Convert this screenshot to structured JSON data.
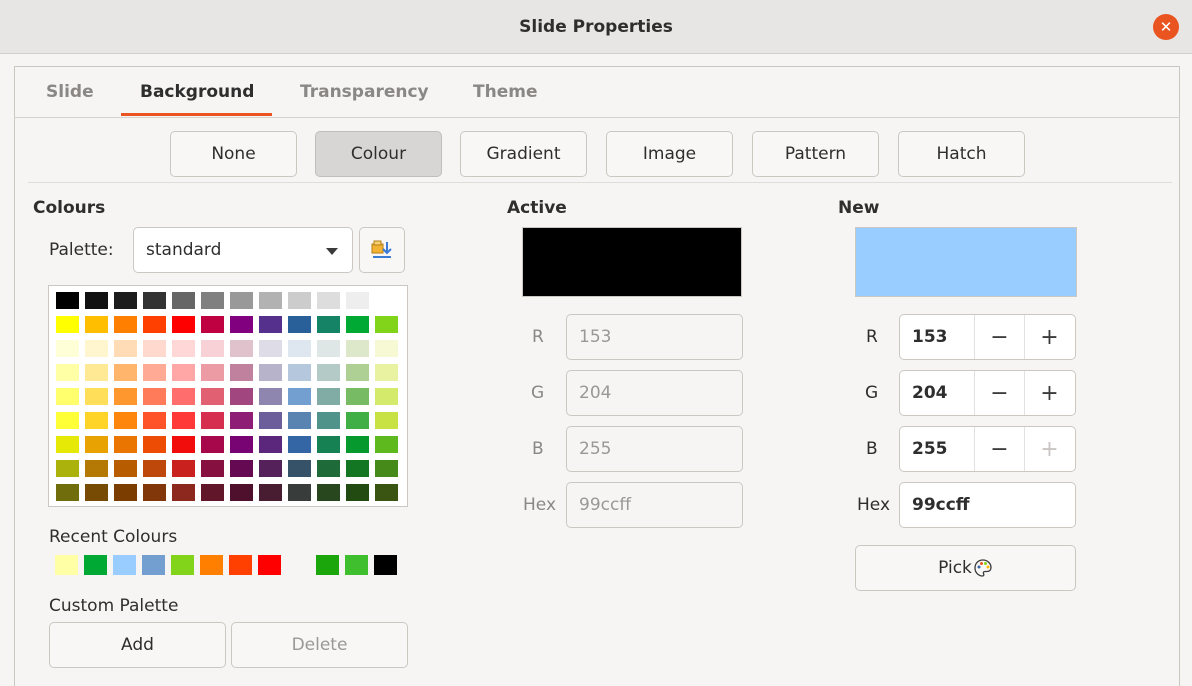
{
  "window": {
    "title": "Slide Properties",
    "close_icon": "close-icon"
  },
  "tabs": [
    {
      "label": "Slide",
      "active": false
    },
    {
      "label": "Background",
      "active": true
    },
    {
      "label": "Transparency",
      "active": false
    },
    {
      "label": "Theme",
      "active": false
    }
  ],
  "fill_types": [
    {
      "label": "None",
      "pressed": false
    },
    {
      "label": "Colour",
      "pressed": true
    },
    {
      "label": "Gradient",
      "pressed": false
    },
    {
      "label": "Image",
      "pressed": false
    },
    {
      "label": "Pattern",
      "pressed": false
    },
    {
      "label": "Hatch",
      "pressed": false
    }
  ],
  "colours": {
    "heading": "Colours",
    "palette_label": "Palette:",
    "palette_value": "standard",
    "palette_icon": "import-palette-icon",
    "grid": [
      [
        "#000000",
        "#111111",
        "#1c1c1c",
        "#333333",
        "#666666",
        "#808080",
        "#999999",
        "#b2b2b2",
        "#cccccc",
        "#dddddd",
        "#eeeeee",
        "#ffffff"
      ],
      [
        "#ffff00",
        "#ffbf00",
        "#ff8000",
        "#ff4000",
        "#ff0000",
        "#bf0041",
        "#800080",
        "#55308d",
        "#2a6099",
        "#158466",
        "#00a933",
        "#81d41a"
      ],
      [
        "#ffffd7",
        "#fff5ce",
        "#ffdbb6",
        "#ffd8ce",
        "#ffd7d7",
        "#f7d1d5",
        "#e0c2cd",
        "#dedce6",
        "#dee6ef",
        "#dee7e5",
        "#dde8cb",
        "#f6f9d4"
      ],
      [
        "#ffffa6",
        "#ffe994",
        "#ffb66c",
        "#ffaa95",
        "#ffa6a6",
        "#ec9ba4",
        "#bf819e",
        "#b7b3ca",
        "#b4c7dc",
        "#b3cac7",
        "#afd095",
        "#e8f2a1"
      ],
      [
        "#ffff6d",
        "#ffde59",
        "#ff972f",
        "#ff7b59",
        "#ff6d6d",
        "#e16173",
        "#a1467e",
        "#8e86ae",
        "#729fcf",
        "#81aca6",
        "#77bc65",
        "#d4ea6b"
      ],
      [
        "#ffff38",
        "#ffd428",
        "#ff860d",
        "#ff5429",
        "#ff3838",
        "#d62e4e",
        "#8d1d75",
        "#6b5e9b",
        "#5983b0",
        "#50938a",
        "#3faf46",
        "#c9e243"
      ],
      [
        "#e6e905",
        "#e8a202",
        "#ea7500",
        "#ed4c05",
        "#f10d0c",
        "#a7074b",
        "#780373",
        "#5b277d",
        "#3465a4",
        "#168253",
        "#069a2e",
        "#5eb91e"
      ],
      [
        "#acb20c",
        "#b47804",
        "#b85c00",
        "#be480a",
        "#c9211e",
        "#861141",
        "#650953",
        "#55215b",
        "#355269",
        "#1e6a39",
        "#127622",
        "#468a1a"
      ],
      [
        "#706e0c",
        "#784b04",
        "#7b3d00",
        "#813709",
        "#8d281e",
        "#611729",
        "#4e102d",
        "#481d32",
        "#383d3c",
        "#28471f",
        "#224b12",
        "#395511"
      ]
    ],
    "recent_label": "Recent Colours",
    "recent": [
      "#ffffa6",
      "#00a933",
      "#99ccff",
      "#729fcf",
      "#81d41a",
      "#ff8000",
      "#ff4000",
      "#ff0000",
      "#f6f5f4",
      "#1ba60b",
      "#3fbf2e",
      "#000000"
    ],
    "custom_label": "Custom Palette",
    "add_label": "Add",
    "delete_label": "Delete"
  },
  "active": {
    "heading": "Active",
    "colour": "#000000",
    "r_label": "R",
    "r": "153",
    "g_label": "G",
    "g": "204",
    "b_label": "B",
    "b": "255",
    "hex_label": "Hex",
    "hex": "99ccff"
  },
  "new": {
    "heading": "New",
    "colour": "#99ccff",
    "r_label": "R",
    "r": "153",
    "g_label": "G",
    "g": "204",
    "b_label": "B",
    "b": "255",
    "hex_label": "Hex",
    "hex": "99ccff",
    "minus": "−",
    "plus": "+",
    "pick_label": "Pick",
    "pick_icon": "colour-palette-icon"
  }
}
